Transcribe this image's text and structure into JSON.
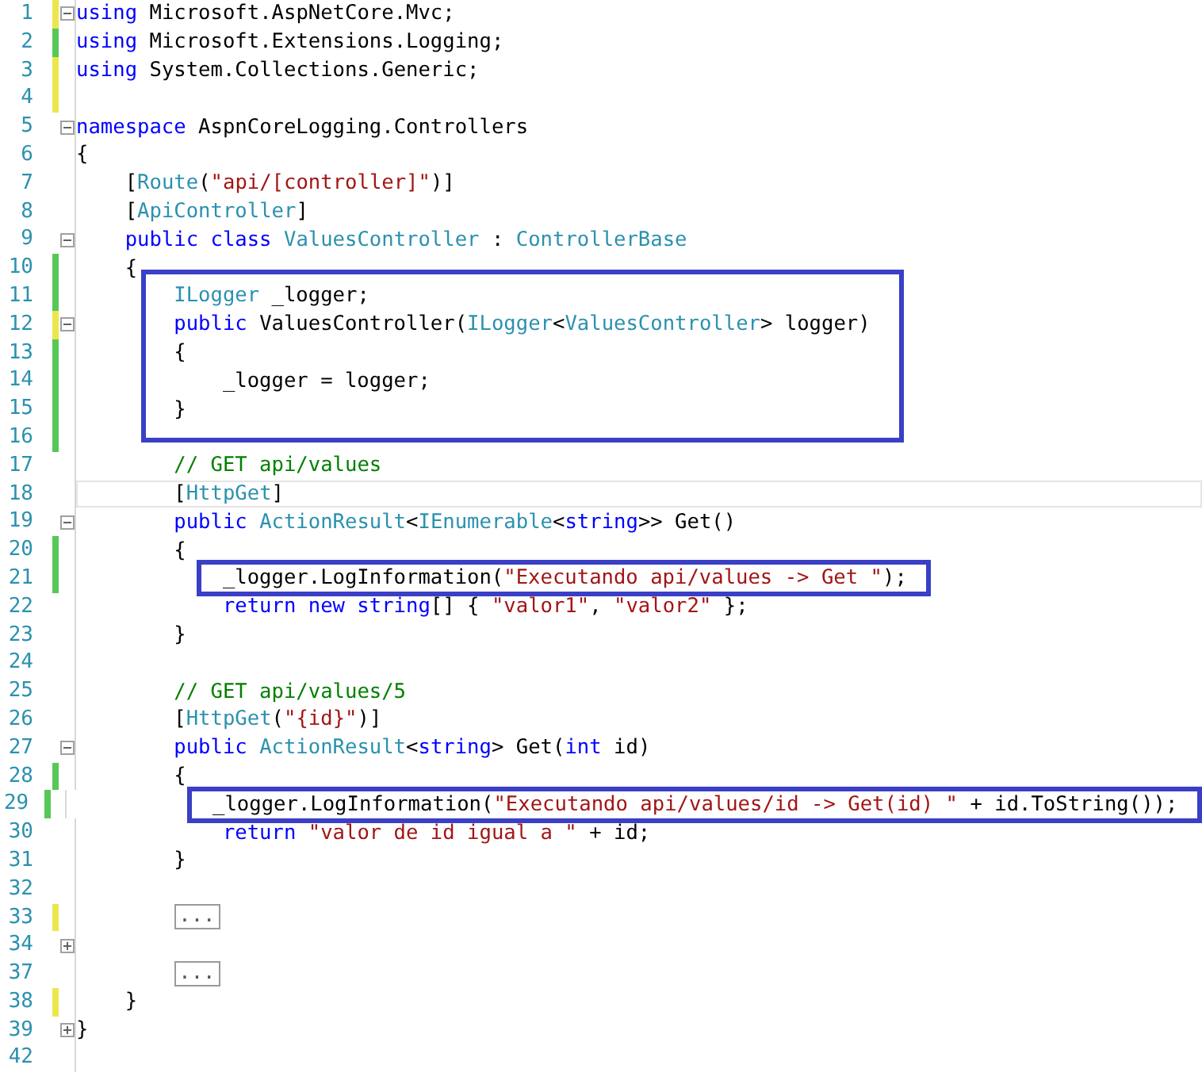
{
  "editor": {
    "blocks": [
      {
        "kind": "plain",
        "lines": [
          {
            "number": "1",
            "color": "#ece64e",
            "expanded": true,
            "tokens": [
              {
                "kind": "keyword",
                "text": "using"
              },
              {
                "kind": "text",
                "text": " Microsoft.AspNetCore.Mvc;"
              }
            ]
          },
          {
            "number": "2",
            "color": "#57c757",
            "tokens": [
              {
                "kind": "keyword",
                "text": "using"
              },
              {
                "kind": "text",
                "text": " Microsoft.Extensions.Logging;"
              }
            ]
          },
          {
            "number": "3",
            "color": "#ece64e",
            "tokens": [
              {
                "kind": "keyword",
                "text": "using"
              },
              {
                "kind": "text",
                "text": " System.Collections.Generic;"
              }
            ]
          },
          {
            "number": "4",
            "color": "#ece64e"
          },
          {
            "number": "5",
            "expanded": true,
            "tokens": [
              {
                "kind": "keyword",
                "text": "namespace"
              },
              {
                "kind": "text",
                "text": " AspnCoreLogging.Controllers"
              }
            ]
          },
          {
            "number": "6",
            "tokens": [
              {
                "kind": "text",
                "text": "{"
              }
            ]
          },
          {
            "number": "7",
            "tokens": [
              {
                "kind": "text",
                "text": "    ["
              },
              {
                "kind": "type",
                "text": "Route"
              },
              {
                "kind": "text",
                "text": "("
              },
              {
                "kind": "string",
                "text": "\"api/[controller]\""
              },
              {
                "kind": "text",
                "text": ")]"
              }
            ]
          },
          {
            "number": "8",
            "tokens": [
              {
                "kind": "text",
                "text": "    ["
              },
              {
                "kind": "type",
                "text": "ApiController"
              },
              {
                "kind": "text",
                "text": "]"
              }
            ]
          },
          {
            "number": "9",
            "expanded": true,
            "tokens": [
              {
                "kind": "keyword",
                "text": "    public class "
              },
              {
                "kind": "type",
                "text": "ValuesController"
              },
              {
                "kind": "text",
                "text": " : "
              },
              {
                "kind": "type",
                "text": "ControllerBase"
              }
            ]
          },
          {
            "number": "10",
            "color": "#57c757",
            "tokens": [
              {
                "kind": "text",
                "text": "    {"
              }
            ]
          }
        ]
      },
      {
        "kind": "highlight",
        "lines": [
          {
            "number": "11",
            "color": "#57c757",
            "tokens": [
              {
                "kind": "type",
                "text": "        ILogger"
              },
              {
                "kind": "text",
                "text": " _logger;"
              }
            ]
          },
          {
            "number": "12",
            "color": "#ece64e",
            "expanded": true,
            "tokens": [
              {
                "kind": "keyword",
                "text": "        public"
              },
              {
                "kind": "text",
                "text": " ValuesController("
              },
              {
                "kind": "type",
                "text": "ILogger"
              },
              {
                "kind": "text",
                "text": "<"
              },
              {
                "kind": "type",
                "text": "ValuesController"
              },
              {
                "kind": "text",
                "text": "> logger)"
              }
            ]
          },
          {
            "number": "13",
            "color": "#57c757",
            "tokens": [
              {
                "kind": "text",
                "text": "        {"
              }
            ]
          },
          {
            "number": "14",
            "color": "#57c757",
            "tokens": [
              {
                "kind": "text",
                "text": "            _logger = logger;"
              }
            ]
          },
          {
            "number": "15",
            "color": "#57c757",
            "tokens": [
              {
                "kind": "text",
                "text": "        }"
              }
            ]
          }
        ]
      },
      {
        "kind": "plain",
        "lines": [
          {
            "number": "16",
            "color": "#57c757"
          },
          {
            "number": "17",
            "tokens": [
              {
                "kind": "comment",
                "text": "        // GET api/values"
              }
            ]
          },
          {
            "number": "18",
            "current": true,
            "tokens": [
              {
                "kind": "text",
                "text": "        ["
              },
              {
                "kind": "type",
                "text": "HttpGet"
              },
              {
                "kind": "text",
                "text": "]"
              }
            ]
          },
          {
            "number": "19",
            "expanded": true,
            "tokens": [
              {
                "kind": "keyword",
                "text": "        public "
              },
              {
                "kind": "type",
                "text": "ActionResult"
              },
              {
                "kind": "text",
                "text": "<"
              },
              {
                "kind": "type",
                "text": "IEnumerable"
              },
              {
                "kind": "text",
                "text": "<"
              },
              {
                "kind": "keyword",
                "text": "string"
              },
              {
                "kind": "text",
                "text": ">> Get()"
              }
            ]
          },
          {
            "number": "20",
            "color": "#57c757",
            "tokens": [
              {
                "kind": "text",
                "text": "        {"
              }
            ]
          }
        ]
      },
      {
        "kind": "highlight",
        "lines": [
          {
            "number": "21",
            "color": "#57c757",
            "tokens": [
              {
                "kind": "text",
                "text": "            _logger.LogInformation("
              },
              {
                "kind": "string",
                "text": "\"Executando api/values -> Get \""
              },
              {
                "kind": "text",
                "text": ");"
              }
            ]
          }
        ]
      },
      {
        "kind": "plain",
        "lines": [
          {
            "number": "22",
            "tokens": [
              {
                "kind": "keyword",
                "text": "            return new string"
              },
              {
                "kind": "text",
                "text": "[] { "
              },
              {
                "kind": "string",
                "text": "\"valor1\""
              },
              {
                "kind": "text",
                "text": ", "
              },
              {
                "kind": "string",
                "text": "\"valor2\""
              },
              {
                "kind": "text",
                "text": " };"
              }
            ]
          },
          {
            "number": "23",
            "tokens": [
              {
                "kind": "text",
                "text": "        }"
              }
            ]
          },
          {
            "number": "24"
          },
          {
            "number": "25",
            "tokens": [
              {
                "kind": "comment",
                "text": "        // GET api/values/5"
              }
            ]
          },
          {
            "number": "26",
            "tokens": [
              {
                "kind": "text",
                "text": "        ["
              },
              {
                "kind": "type",
                "text": "HttpGet"
              },
              {
                "kind": "text",
                "text": "("
              },
              {
                "kind": "string",
                "text": "\"{id}\""
              },
              {
                "kind": "text",
                "text": ")]"
              }
            ]
          },
          {
            "number": "27",
            "expanded": true,
            "tokens": [
              {
                "kind": "keyword",
                "text": "        public "
              },
              {
                "kind": "type",
                "text": "ActionResult"
              },
              {
                "kind": "text",
                "text": "<"
              },
              {
                "kind": "keyword",
                "text": "string"
              },
              {
                "kind": "text",
                "text": "> Get("
              },
              {
                "kind": "keyword",
                "text": "int"
              },
              {
                "kind": "text",
                "text": " id)"
              }
            ]
          },
          {
            "number": "28",
            "color": "#57c757",
            "tokens": [
              {
                "kind": "text",
                "text": "        {"
              }
            ]
          }
        ]
      },
      {
        "kind": "highlight",
        "lines": [
          {
            "number": "29",
            "color": "#57c757",
            "tokens": [
              {
                "kind": "text",
                "text": "            _logger.LogInformation("
              },
              {
                "kind": "string",
                "text": "\"Executando api/values/id -> Get(id) \""
              },
              {
                "kind": "text",
                "text": " + id.ToString());"
              }
            ]
          }
        ]
      },
      {
        "kind": "plain",
        "lines": [
          {
            "number": "30",
            "tokens": [
              {
                "kind": "keyword",
                "text": "            return "
              },
              {
                "kind": "string",
                "text": "\"valor de id igual a \""
              },
              {
                "kind": "text",
                "text": " + id;"
              }
            ]
          },
          {
            "number": "31",
            "tokens": [
              {
                "kind": "text",
                "text": "        }"
              }
            ]
          },
          {
            "number": "32"
          },
          {
            "number": "33",
            "color": "#ece64e",
            "tokens": [
              {
                "kind": "collapsed",
                "text": "..."
              }
            ]
          },
          {
            "number": "34",
            "expanded": false
          },
          {
            "number": "37",
            "tokens": [
              {
                "kind": "collapsed",
                "text": "..."
              }
            ]
          },
          {
            "number": "38",
            "color": "#ece64e",
            "tokens": [
              {
                "kind": "text",
                "text": "    }"
              }
            ]
          },
          {
            "number": "39",
            "expanded": false,
            "tokens": [
              {
                "kind": "text",
                "text": "}"
              }
            ]
          },
          {
            "number": "42"
          }
        ]
      }
    ]
  }
}
